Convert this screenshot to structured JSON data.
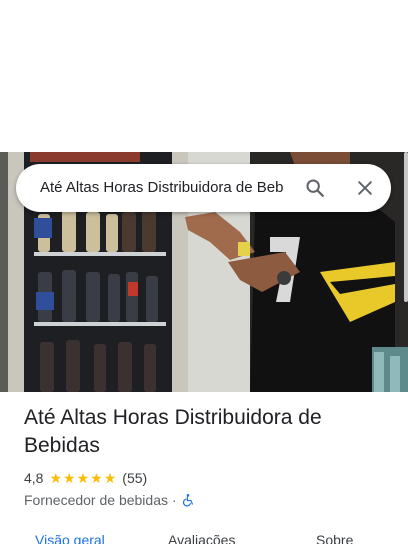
{
  "search": {
    "query": "Até Altas Horas Distribuidora de Beb",
    "search_icon": "search-icon",
    "close_icon": "close-icon"
  },
  "place": {
    "title": "Até Altas Horas Distribuidora de Bebidas",
    "rating": "4,8",
    "stars": 5,
    "review_count": "(55)",
    "category": "Fornecedor de bebidas",
    "separator": "·",
    "accessibility_icon": "wheelchair-icon"
  },
  "tabs": [
    {
      "label": "Visão geral",
      "active": true
    },
    {
      "label": "Avaliações",
      "active": false
    },
    {
      "label": "Sobre",
      "active": false
    }
  ],
  "colors": {
    "accent": "#1a73e8",
    "star": "#fbbc04",
    "text_primary": "#202124",
    "text_secondary": "#5f6368"
  }
}
